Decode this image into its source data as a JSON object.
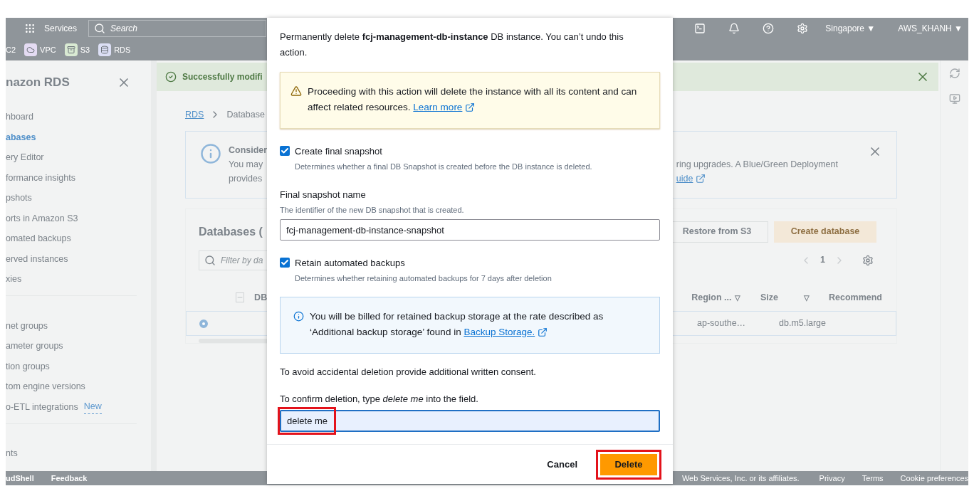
{
  "nav": {
    "services": "Services",
    "search_placeholder": "Search",
    "region": "Singapore ▼",
    "account": "AWS_KHANH ▼"
  },
  "favorites": [
    {
      "label": "C2"
    },
    {
      "label": "VPC",
      "color": "#e4dbf3"
    },
    {
      "label": "S3",
      "color": "#d9ead3"
    },
    {
      "label": "RDS",
      "color": "#dcdff5"
    }
  ],
  "sidebar": {
    "title": "nazon RDS",
    "groups": [
      [
        {
          "label": "hboard",
          "selected": false
        },
        {
          "label": "abases",
          "selected": true
        },
        {
          "label": "ery Editor",
          "selected": false
        },
        {
          "label": "formance insights",
          "selected": false
        },
        {
          "label": "pshots",
          "selected": false
        },
        {
          "label": "orts in Amazon S3",
          "selected": false
        },
        {
          "label": "omated backups",
          "selected": false
        },
        {
          "label": "erved instances",
          "selected": false
        },
        {
          "label": "xies",
          "selected": false
        }
      ],
      [
        {
          "label": "net groups",
          "selected": false
        },
        {
          "label": "ameter groups",
          "selected": false
        },
        {
          "label": "tion groups",
          "selected": false
        },
        {
          "label": "tom engine versions",
          "selected": false
        },
        {
          "label": "o-ETL integrations",
          "selected": false,
          "badge": "New"
        }
      ],
      [
        {
          "label": "nts",
          "selected": false
        }
      ]
    ]
  },
  "flash": {
    "message": "Successfully modifi"
  },
  "breadcrumbs": [
    "RDS",
    "Database"
  ],
  "info": {
    "title": "Consider",
    "lines": [
      "You may",
      "provides"
    ],
    "right_line": "ring upgrades. A Blue/Green Deployment",
    "link": "uide"
  },
  "databases": {
    "title": "Databases (",
    "filter_placeholder": "Filter by da",
    "buttons": [
      "Restore from S3",
      "Create database"
    ],
    "page": "1",
    "columns": [
      {
        "label": "DB"
      },
      {
        "label": "Region ...",
        "filter": "▽"
      },
      {
        "label": "Size",
        "filter": "▽"
      },
      {
        "label": "Recommend"
      }
    ],
    "rows": [
      {
        "selected": true,
        "cells": [
          "",
          "ap-southe…",
          "db.m5.large"
        ]
      }
    ]
  },
  "footer": {
    "left": [
      "udShell",
      "Feedback"
    ],
    "copyright": "Web Services, Inc. or its affiliates.",
    "links": [
      "Privacy",
      "Terms",
      "Cookie preferences"
    ]
  },
  "modal": {
    "intro": "Permanently delete **fcj-management-db-instance** DB instance. You can’t undo this action.",
    "warning": {
      "text": "Proceeding with this action will delete the instance with all its content and can affect related resources.",
      "link": "Learn more"
    },
    "options": [
      {
        "kind": "checkbox",
        "label": "Create final snapshot",
        "description": "Determines whether a final DB Snapshot is created before the DB instance is deleted.",
        "checked": true
      },
      {
        "kind": "field",
        "label": "Final snapshot name",
        "description": "The identifier of the new DB snapshot that is created.",
        "value": "fcj-management-db-instance-snapshot"
      },
      {
        "kind": "checkbox",
        "label": "Retain automated backups",
        "description": "Determines whether retaining automated backups for 7 days after deletion",
        "checked": true
      }
    ],
    "billing": {
      "text": "You will be billed for retained backup storage at the rate described as ‘Additional backup storage’ found in",
      "link": "Backup Storage."
    },
    "consent": "To avoid accidental deletion provide additional written consent.",
    "confirm_label": "To confirm deletion, type *delete me* into the field.",
    "confirm_value": "delete me",
    "confirm_highlighted": true,
    "cancel": "Cancel",
    "delete": "Delete",
    "delete_highlighted": true
  }
}
